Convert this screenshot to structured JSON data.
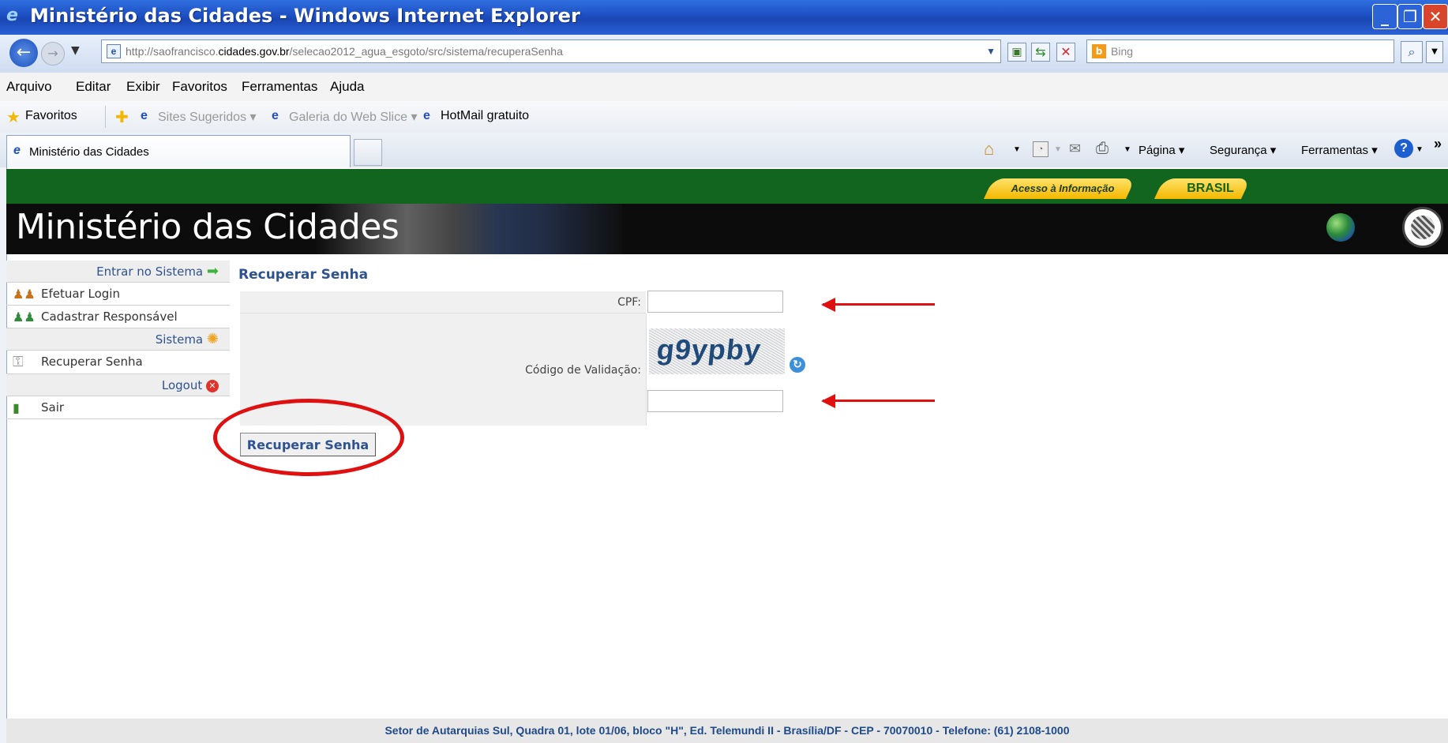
{
  "window": {
    "title": "Ministério das Cidades - Windows Internet Explorer"
  },
  "address": {
    "url_prefix": "http://saofrancisco.",
    "url_domain": "cidades.gov.br",
    "url_path": "/selecao2012_agua_esgoto/src/sistema/recuperaSenha",
    "search_engine": "Bing"
  },
  "menu": [
    "Arquivo",
    "Editar",
    "Exibir",
    "Favoritos",
    "Ferramentas",
    "Ajuda"
  ],
  "favorites": {
    "label": "Favoritos",
    "items": [
      "Sites Sugeridos ▾",
      "Galeria do Web Slice ▾",
      "HotMail gratuito"
    ]
  },
  "tabs": {
    "active": "Ministério das Cidades"
  },
  "command_bar": {
    "page": "Página ▾",
    "security": "Segurança ▾",
    "tools": "Ferramentas ▾"
  },
  "site": {
    "access_info": "Acesso à Informação",
    "brasil": "BRASIL",
    "banner_title": "Ministério das Cidades"
  },
  "sidebar": {
    "sections": [
      {
        "header": "Entrar no Sistema",
        "items": [
          "Efetuar Login",
          "Cadastrar Responsável"
        ]
      },
      {
        "header": "Sistema",
        "items": [
          "Recuperar Senha"
        ]
      },
      {
        "header": "Logout",
        "items": [
          "Sair"
        ]
      }
    ]
  },
  "form": {
    "heading": "Recuperar Senha",
    "cpf_label": "CPF:",
    "cpf_value": "",
    "code_label": "Código de Validação:",
    "captcha_text": "g9ypby",
    "code_value": "",
    "submit_label": "Recuperar Senha"
  },
  "footer": {
    "text": "Setor de Autarquias Sul, Quadra 01, lote 01/06, bloco \"H\", Ed. Telemundi II - Brasília/DF - CEP - 70070010 - Telefone: (61) 2108-1000"
  },
  "colors": {
    "green_bar": "#12651f",
    "link_blue": "#2e5390",
    "annotation_red": "#e01010",
    "ie_blue": "#1d4fc2"
  }
}
